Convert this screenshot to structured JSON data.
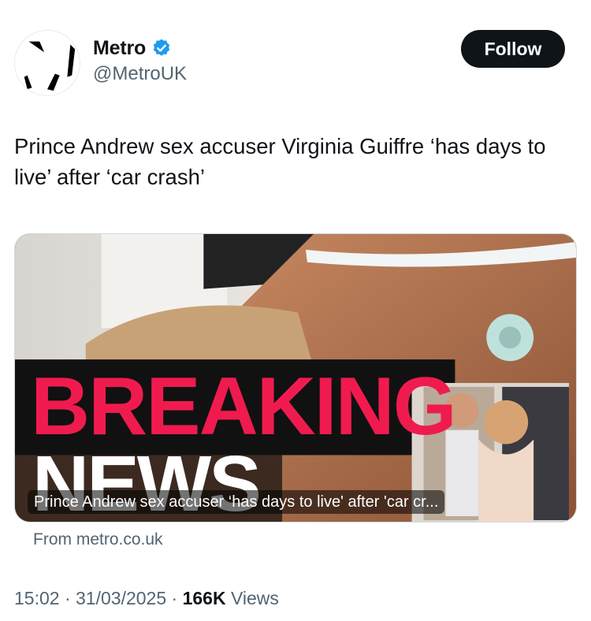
{
  "author": {
    "display_name": "Metro",
    "handle": "@MetroUK",
    "verified": true,
    "avatar_icon": "metro-logo-icon"
  },
  "follow_label": "Follow",
  "tweet_text": "Prince Andrew sex accuser Virginia Guiffre ‘has days to live’ after ‘car crash’",
  "card": {
    "headline_line1": "BREAKING",
    "headline_line2": "NEWS",
    "caption": "Prince Andrew sex accuser ‘has days to live' after 'car cr...",
    "source": "From metro.co.uk"
  },
  "meta": {
    "time": "15:02",
    "separator": " · ",
    "date": "31/03/2025",
    "views_count": "166K",
    "views_label": " Views"
  },
  "colors": {
    "breaking_red": "#ef1b4f",
    "verified_blue": "#1d9bf0",
    "text_primary": "#0f1419",
    "text_secondary": "#536471"
  }
}
